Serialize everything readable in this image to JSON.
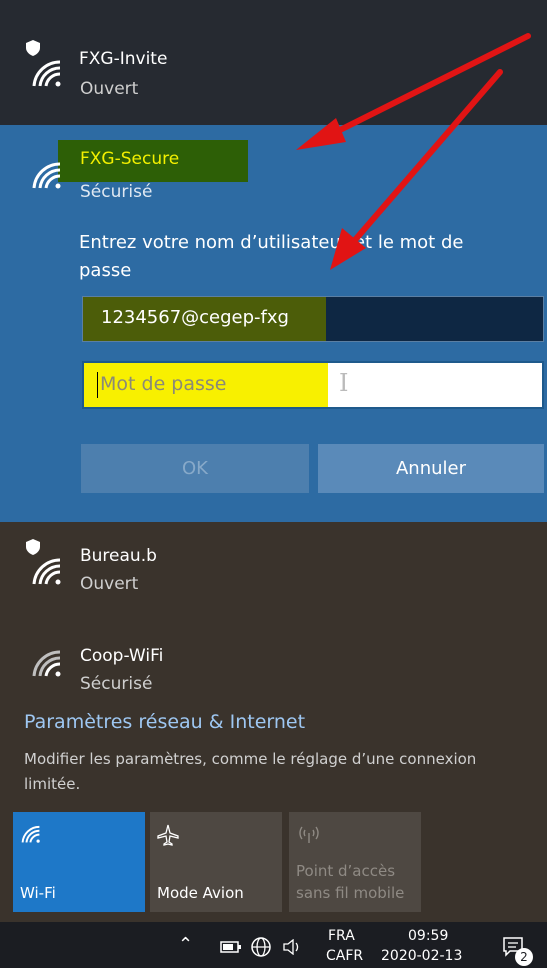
{
  "networks": [
    {
      "name": "FXG-Invite",
      "status": "Ouvert"
    },
    {
      "name": "FXG-Secure",
      "status": "Sécurisé"
    },
    {
      "name": "Bureau.b",
      "status": "Ouvert"
    },
    {
      "name": "Coop-WiFi",
      "status": "Sécurisé"
    }
  ],
  "login": {
    "prompt": "Entrez votre nom d’utilisateur et le mot de passe",
    "username_value": "1234567@cegep-fxg",
    "password_placeholder": "Mot de passe",
    "ok_label": "OK",
    "cancel_label": "Annuler"
  },
  "settings": {
    "link": "Paramètres réseau & Internet",
    "description": "Modifier les paramètres, comme le réglage d’une connexion limitée."
  },
  "tiles": [
    {
      "label": "Wi-Fi",
      "icon": "wifi-icon",
      "active": true
    },
    {
      "label": "Mode Avion",
      "icon": "airplane-icon",
      "active": false
    },
    {
      "label": "Point d’accès sans fil mobile",
      "icon": "hotspot-icon",
      "active": false
    }
  ],
  "taskbar": {
    "language_top": "FRA",
    "language_bottom": "CAFR",
    "time": "09:59",
    "date": "2020-02-13",
    "notification_count": "2"
  },
  "colors": {
    "accent": "#1e78c8",
    "highlight_green": "#2d5f06",
    "highlight_yellow": "#f8f000",
    "arrow_red": "#e11414"
  }
}
